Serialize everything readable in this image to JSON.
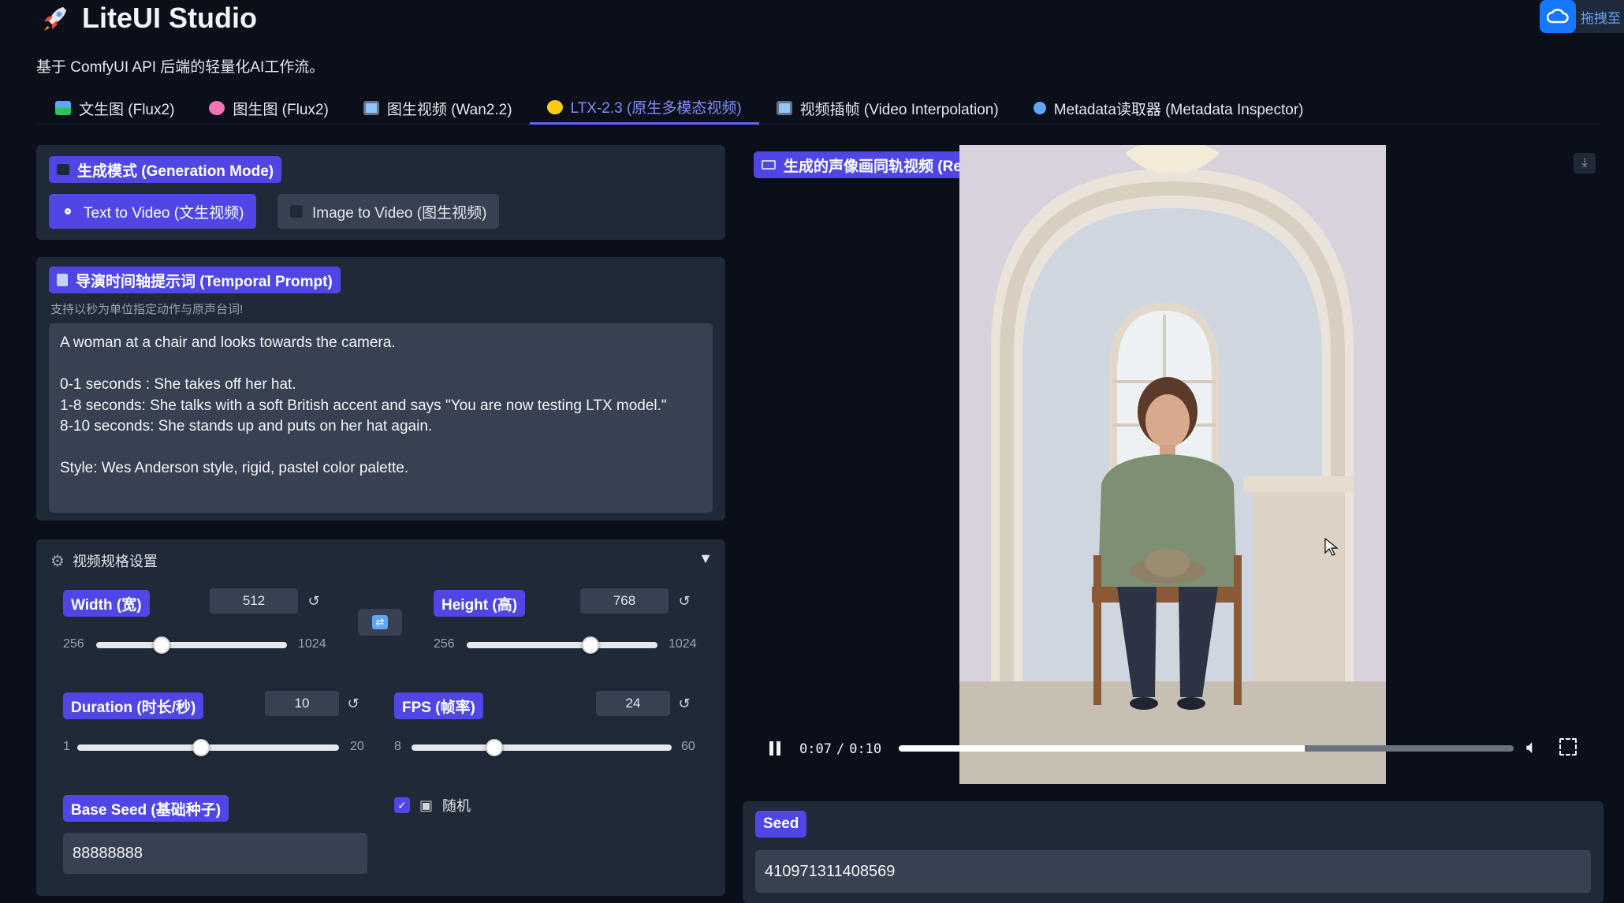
{
  "app": {
    "title": "LiteUI Studio",
    "subtitle": "基于 ComfyUI API 后端的轻量化AI工作流。",
    "badge_text": "拖拽至"
  },
  "tabs": [
    {
      "label": "文生图 (Flux2)",
      "icon": "image-icon"
    },
    {
      "label": "图生图 (Flux2)",
      "icon": "palette-icon"
    },
    {
      "label": "图生视频 (Wan2.2)",
      "icon": "film-icon"
    },
    {
      "label": "LTX-2.3 (原生多模态视频)",
      "icon": "sparkle-icon",
      "active": true
    },
    {
      "label": "视频插帧 (Video Interpolation)",
      "icon": "film-icon"
    },
    {
      "label": "Metadata读取器 (Metadata Inspector)",
      "icon": "magnifier-icon"
    }
  ],
  "generation_mode": {
    "label": "生成模式 (Generation Mode)",
    "options": [
      "Text to Video (文生视频)",
      "Image to Video (图生视频)"
    ],
    "selected": "Text to Video (文生视频)"
  },
  "temporal_prompt": {
    "label": "导演时间轴提示词 (Temporal Prompt)",
    "hint": "支持以秒为单位指定动作与原声台词!",
    "value": "A woman at a chair and looks towards the camera.\n\n0-1 seconds : She takes off her hat.\n1-8 seconds: She talks with a soft British accent and says \"You are now testing LTX model.\"\n8-10 seconds: She stands up and puts on her hat again.\n\nStyle: Wes Anderson style, rigid, pastel color palette."
  },
  "video_settings": {
    "title": "视频规格设置",
    "width": {
      "label": "Width (宽)",
      "value": "512",
      "min": "256",
      "max": "1024"
    },
    "height": {
      "label": "Height (高)",
      "value": "768",
      "min": "256",
      "max": "1024"
    },
    "duration": {
      "label": "Duration (时长/秒)",
      "value": "10",
      "min": "1",
      "max": "20"
    },
    "fps": {
      "label": "FPS (帧率)",
      "value": "24",
      "min": "8",
      "max": "60"
    },
    "base_seed": {
      "label": "Base Seed (基础种子)",
      "value": "88888888"
    },
    "random": {
      "label": "随机",
      "checked": true
    }
  },
  "result": {
    "label": "生成的声像画同轨视频 (Result)",
    "current_time": "0:07",
    "duration": "0:10",
    "progress": 0.66
  },
  "seed": {
    "label": "Seed",
    "value": "410971311408569"
  },
  "colors": {
    "accent": "#4f46e5",
    "active_tab": "#818cf8",
    "background": "#0b0f19",
    "panel": "#1f2937"
  }
}
